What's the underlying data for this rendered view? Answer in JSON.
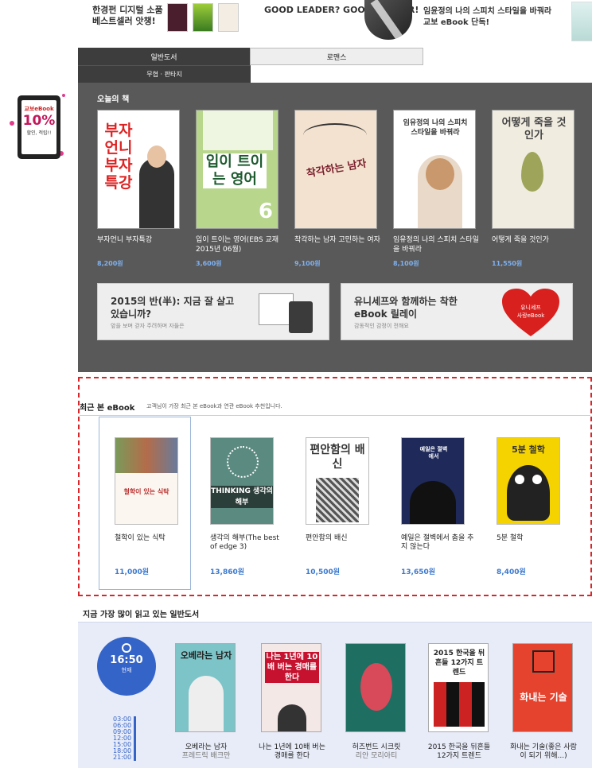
{
  "top_banner": {
    "item1": "한경펀 디지털 소품 베스트셀러 앗챙!",
    "item2": "GOOD LEADER? GOOD READER!",
    "item3": "임윤정의 나의 스피치 스타일을 바꿔라 교보 eBook 단독!"
  },
  "side_ad": {
    "brand": "교보eBook",
    "percent": "10%",
    "caption": "할인, 적립!!"
  },
  "tabs": {
    "general": "일반도서",
    "romance": "로맨스",
    "sub": "무협 · 판타지"
  },
  "today": {
    "title": "오늘의 책",
    "books": [
      {
        "title": "부자언니 부자특강",
        "price": "8,200원",
        "cover_text": "부자언니 부자특강"
      },
      {
        "title": "입이 트이는 영어(EBS 교재 2015년 06월)",
        "price": "3,600원",
        "cover_text": "입이 트이는 영어"
      },
      {
        "title": "착각하는 남자 고민하는 여자",
        "price": "9,100원",
        "cover_text": "착각하는 남자"
      },
      {
        "title": "임유정의 나의 스피치 스타일을 바꿔라",
        "price": "8,100원",
        "cover_text": "임유정의 나의 스피치 스타일을 바꿔라"
      },
      {
        "title": "어떻게 죽을 것인가",
        "price": "11,550원",
        "cover_text": "어떻게 죽을 것인가"
      }
    ],
    "promo1": {
      "title": "2015의 반(半): 지금 잘 살고 있습니까?",
      "sub": "앞을 보며 걷자 주려하며 자들은"
    },
    "promo2": {
      "title": "유니세프와 함께하는 착한 eBook 릴레이",
      "sub": "감동적인 감정이 전해요",
      "heart_text": "유니세프 사랑eBook"
    }
  },
  "recent": {
    "title": "최근 본 eBook",
    "subtitle": "고객님이 가장 최근 본 eBook과 연관 eBook 추천입니다.",
    "books": [
      {
        "title": "철학이 있는 식탁",
        "price": "11,000원",
        "cover_text": "철학이 있는 식탁"
      },
      {
        "title": "생각의 해부(The best of edge 3)",
        "price": "13,860원",
        "cover_text": "THINKING 생각의 해부"
      },
      {
        "title": "편안함의 배신",
        "price": "10,500원",
        "cover_text": "편안함의 배신"
      },
      {
        "title": "예일은 절벽에서 춤을 추지 않는다",
        "price": "13,650원",
        "cover_text": "예일은 절벽에서"
      },
      {
        "title": "5분 철학",
        "price": "8,400원",
        "cover_text": "5분 철학"
      }
    ]
  },
  "popular": {
    "title": "지금 가장 많이 읽고 있는 일반도서",
    "clock_time": "16:50",
    "clock_label": "현재",
    "hours": [
      "03:00",
      "06:00",
      "09:00",
      "12:00",
      "15:00",
      "18:00",
      "21:00"
    ],
    "books": [
      {
        "title": "오베라는 남자",
        "author": "프레드릭 배크만",
        "cover_text": "오베라는 남자"
      },
      {
        "title": "나는 1년에 10배 버는 경매를 한다",
        "author": "",
        "cover_text": "나는 1년에 10배 버는 경매를 한다"
      },
      {
        "title": "허즈번드 시크릿",
        "author": "리안 모리아티",
        "cover_text": ""
      },
      {
        "title": "2015 한국을 뒤흔들 12가지 트렌드",
        "author": "",
        "cover_text": "2015 한국을 뒤흔들 12가지 트렌드"
      },
      {
        "title": "화내는 기술(좋은 사람이 되기 위해...)",
        "author": "",
        "cover_text": "화내는 기술"
      }
    ]
  }
}
